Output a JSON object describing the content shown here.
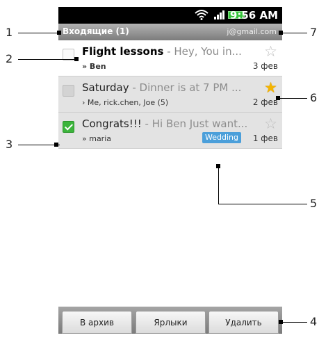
{
  "status_bar": {
    "time": "9:56 AM"
  },
  "header": {
    "title": "Входящие (1)",
    "account": "j@gmail.com"
  },
  "messages": [
    {
      "subject": "Flight lessons",
      "preview": " - Hey, You in...",
      "from": "» Ben",
      "date": "3 фев",
      "starred": false,
      "unread": true,
      "checked": false,
      "label": ""
    },
    {
      "subject": "Saturday",
      "preview": " - Dinner is at 7 PM ...",
      "from": "› Me, rick.chen, Joe (5)",
      "date": "2 фев",
      "starred": true,
      "unread": false,
      "checked": false,
      "label": ""
    },
    {
      "subject": "Congrats!!!",
      "preview": " - Hi Ben Just want...",
      "from": "» maria",
      "date": "1 фев",
      "starred": false,
      "unread": false,
      "checked": true,
      "label": "Wedding"
    }
  ],
  "actions": {
    "archive": "В архив",
    "labels": "Ярлыки",
    "delete": "Удалить"
  },
  "callouts": [
    "1",
    "2",
    "3",
    "4",
    "5",
    "6",
    "7"
  ],
  "colors": {
    "star_on": "#f4b400",
    "label_bg": "#4b9fda",
    "check_green": "#3cb43c"
  },
  "icons": [
    "wifi-icon",
    "signal-icon",
    "battery-icon",
    "star-icon",
    "checkbox-icon"
  ]
}
